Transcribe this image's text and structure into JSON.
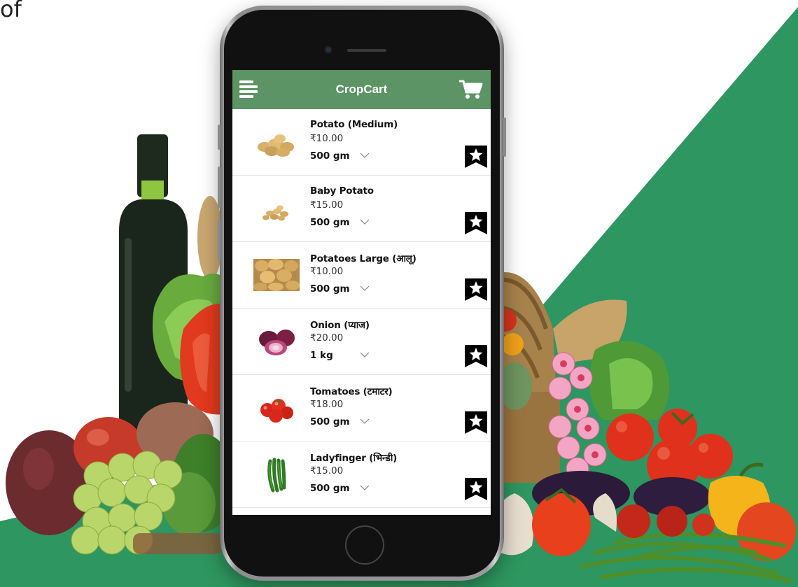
{
  "corner_text": "of",
  "app": {
    "title": "CropCart",
    "menu_icon": "menu-icon",
    "cart_icon": "shopping-cart-icon",
    "header_color": "#5c9465"
  },
  "background": {
    "green_color": "#2e9660"
  },
  "products": [
    {
      "name": "Potato (Medium)",
      "price": "₹10.00",
      "quantity": "500 gm",
      "image": "potato",
      "bookmark_icon": "star-bookmark-icon"
    },
    {
      "name": "Baby Potato",
      "price": "₹15.00",
      "quantity": "500 gm",
      "image": "baby-potato",
      "bookmark_icon": "star-bookmark-icon"
    },
    {
      "name": "Potatoes Large (आलू)",
      "price": "₹10.00",
      "quantity": "500 gm",
      "image": "potatoes-large",
      "bookmark_icon": "star-bookmark-icon"
    },
    {
      "name": "Onion (प्याज)",
      "price": "₹20.00",
      "quantity": "1 kg",
      "image": "onion",
      "bookmark_icon": "star-bookmark-icon"
    },
    {
      "name": "Tomatoes (टमाटर)",
      "price": "₹18.00",
      "quantity": "500 gm",
      "image": "tomato",
      "bookmark_icon": "star-bookmark-icon"
    },
    {
      "name": "Ladyfinger (भिन्डी)",
      "price": "₹15.00",
      "quantity": "500 gm",
      "image": "ladyfinger",
      "bookmark_icon": "star-bookmark-icon"
    }
  ]
}
